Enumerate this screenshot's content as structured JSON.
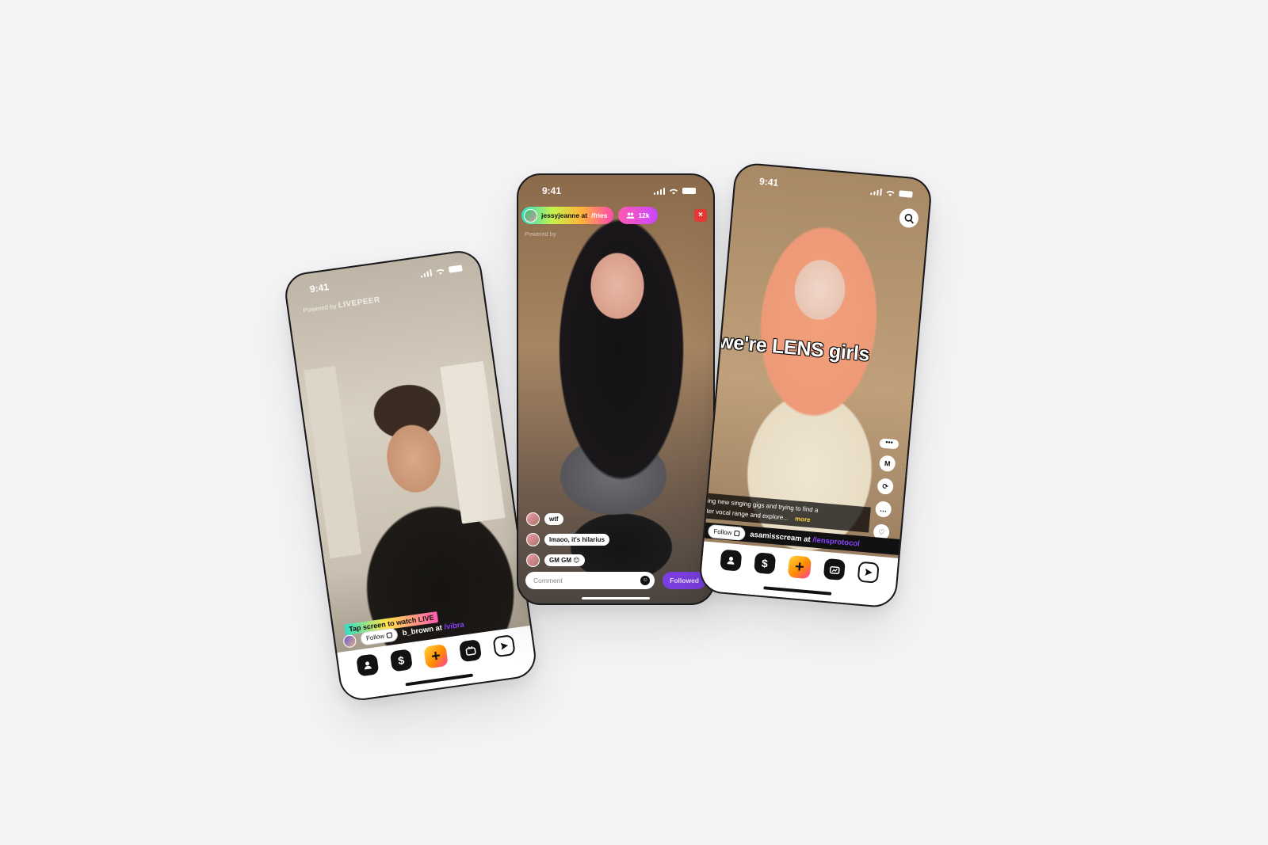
{
  "phones": [
    {
      "id": "left",
      "status_time": "9:41",
      "powered_by": "Powered by",
      "powered_brand": "LIVEPEER",
      "cta": "Tap screen to watch LIVE",
      "follow_label": "Follow",
      "creator": "b_brown at",
      "channel": "/vibra",
      "nav": [
        "profile-icon",
        "dollar-icon",
        "plus-icon",
        "tv-icon",
        "send-icon"
      ]
    },
    {
      "id": "center",
      "status_time": "9:41",
      "host": "jessyjeanne at",
      "channel": "/fries",
      "viewers": "12k",
      "powered_by": "Powered by",
      "chat": [
        {
          "text": "wtf"
        },
        {
          "text": "lmaoo, it's hilarius"
        },
        {
          "text": "GM GM 😊"
        }
      ],
      "comment_placeholder": "Comment",
      "followed_label": "Followed"
    },
    {
      "id": "right",
      "status_time": "9:41",
      "overlay_caption": "we're LENS girls",
      "description_line1": "ing new singing gigs and trying to find a",
      "description_line2": "ter vocal range and explore...",
      "more_label": "more",
      "follow_label": "Follow",
      "creator": "asamisscream at",
      "channel": "/lensprotocol",
      "side_actions": [
        "more-dots-icon",
        "m-logo-icon",
        "remix-icon",
        "comment-icon",
        "heart-icon"
      ],
      "nav": [
        "profile-icon",
        "dollar-icon",
        "plus-icon",
        "chart-tv-icon",
        "send-icon"
      ]
    }
  ],
  "colors": {
    "background": "#f4f4f6",
    "accent_purple": "#8c43ff",
    "viewer_pill": "#ff5ab0",
    "close": "#e53935",
    "more": "#ffd33d"
  }
}
